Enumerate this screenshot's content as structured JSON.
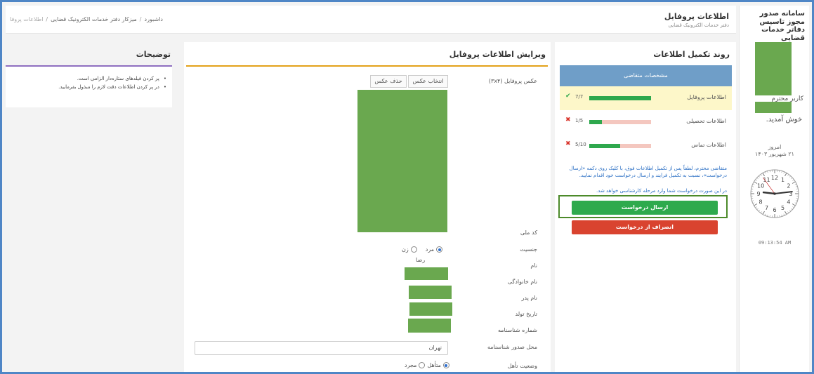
{
  "header": {
    "page_title": "اطلاعات پروفایل",
    "page_subtitle": "دفتر خدمات الکترونیک قضایی",
    "breadcrumb": [
      "داشبورد",
      "میزکار دفتر خدمات الکترونیک قضایی",
      "اطلاعات پروفا"
    ]
  },
  "sidebar": {
    "app_title": "سامانه صدور مجوز تاسیس دفاتر خدمات قضایی",
    "greeting": "کاربر محترم",
    "welcome": "خوش آمدید.",
    "today_label": "امروز",
    "today_date": "۲۱ شهریور ۱۴۰۳",
    "time": "09:13:54 AM",
    "clock_numbers": [
      "12",
      "1",
      "2",
      "3",
      "4",
      "5",
      "6",
      "7",
      "8",
      "9",
      "10",
      "11"
    ],
    "clock_time": {
      "hour": 9,
      "minute": 13,
      "second": 54
    }
  },
  "progress": {
    "heading": "روند تکمیل اطلاعات",
    "spec_header": "مشخصات متقاضی",
    "items": [
      {
        "label": "اطلاعات پروفایل",
        "count": "7/7",
        "fraction": 1.0,
        "status": "✔",
        "ok": true
      },
      {
        "label": "اطلاعات تحصیلی",
        "count": "1/5",
        "fraction": 0.2,
        "status": "✖",
        "ok": false
      },
      {
        "label": "اطلاعات تماس",
        "count": "5/10",
        "fraction": 0.5,
        "status": "✖",
        "ok": false
      }
    ],
    "notice": "متقاضی محترم، لطفاً پس از تکمیل اطلاعات فوق، با کلیک روی دکمه «ارسال درخواست»، نسبت به تکمیل فرایند و ارسال درخواست خود اقدام نمایید.",
    "notice2": "در این صورت درخواست شما وارد مرحله کارشناسی خواهد شد.",
    "submit_button": "ارسال درخواست",
    "cancel_button": "انصراف از درخواست",
    "colors": {
      "submit": "#2eaa4d",
      "cancel": "#d9432f",
      "header": "#6f9ec8"
    }
  },
  "edit": {
    "heading": "ویرایش اطلاعات پروفایل",
    "photo_label": "عکس پروفایل (۳x۴)",
    "select_photo": "انتخاب عکس",
    "delete_photo": "حذف عکس",
    "national_code_label": "کد ملی",
    "gender_label": "جنسیت",
    "gender_male": "مرد",
    "gender_female": "زن",
    "name_label": "نام",
    "name_value": "رضا",
    "family_label": "نام خانوادگی",
    "father_label": "نام پدر",
    "birth_label": "تاریخ تولد",
    "id_number_label": "شماره شناسنامه",
    "issue_place_label": "محل صدور شناسنامه",
    "issue_place_value": "تهران",
    "marital_label": "وضعیت تأهل",
    "marital_single": "مجرد",
    "marital_married": "متأهل"
  },
  "descriptions": {
    "heading": "توضیحات",
    "items": [
      "پر کردن فیلدهای ستاره‌دار الزامی است.",
      "در پر کردن اطلاعات دقت لازم را مبذول بفرمایید."
    ]
  }
}
